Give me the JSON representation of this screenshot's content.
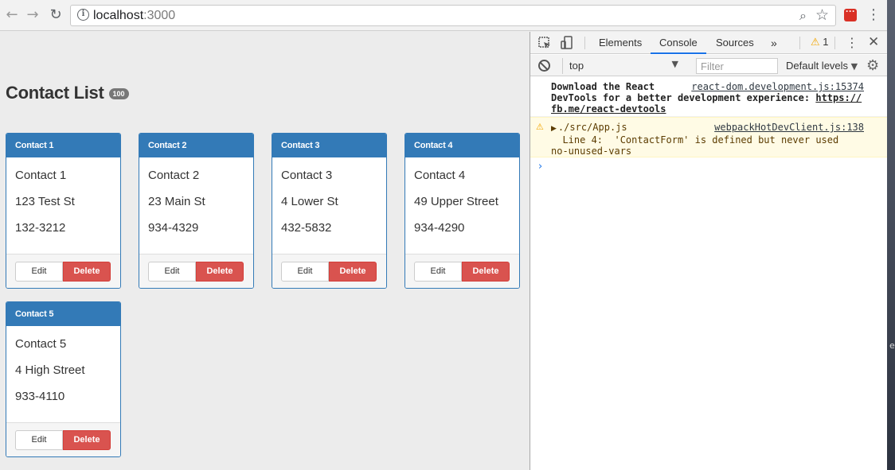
{
  "browser": {
    "url_host": "localhost",
    "url_port": ":3000",
    "back_icon": "←",
    "forward_icon": "→",
    "reload_icon": "↻",
    "zoom_icon": "🔍",
    "star_icon": "☆",
    "menu_icon": "⋮"
  },
  "page": {
    "title": "Contact List",
    "badge": "100",
    "contacts": [
      {
        "header": "Contact 1",
        "name": "Contact 1",
        "address": "123 Test St",
        "phone": "132-3212"
      },
      {
        "header": "Contact 2",
        "name": "Contact 2",
        "address": "23 Main St",
        "phone": "934-4329"
      },
      {
        "header": "Contact 3",
        "name": "Contact 3",
        "address": "4 Lower St",
        "phone": "432-5832"
      },
      {
        "header": "Contact 4",
        "name": "Contact 4",
        "address": "49 Upper Street",
        "phone": "934-4290"
      },
      {
        "header": "Contact 5",
        "name": "Contact 5",
        "address": "4 High Street",
        "phone": "933-4110"
      }
    ],
    "edit_label": "Edit",
    "delete_label": "Delete",
    "colors": {
      "primary": "#337ab7",
      "danger": "#d9534f"
    }
  },
  "devtools": {
    "tabs": [
      "Elements",
      "Console",
      "Sources"
    ],
    "active_tab": "Console",
    "more_tabs": "»",
    "warning_count": "1",
    "context": "top",
    "filter_placeholder": "Filter",
    "levels": "Default levels",
    "messages": {
      "info": {
        "line1": "Download the React",
        "line2": "DevTools for a better development experience: ",
        "link1": "https://",
        "link2": "fb.me/react-devtools",
        "source": "react-dom.development.js:15374"
      },
      "warn": {
        "path": "./src/App.js",
        "line2": "  Line 4:  'ContactForm' is defined but never used",
        "line3": "no-unused-vars",
        "source": "webpackHotDevClient.js:138"
      }
    },
    "prompt": "›"
  },
  "desktop_strip_text": "e"
}
